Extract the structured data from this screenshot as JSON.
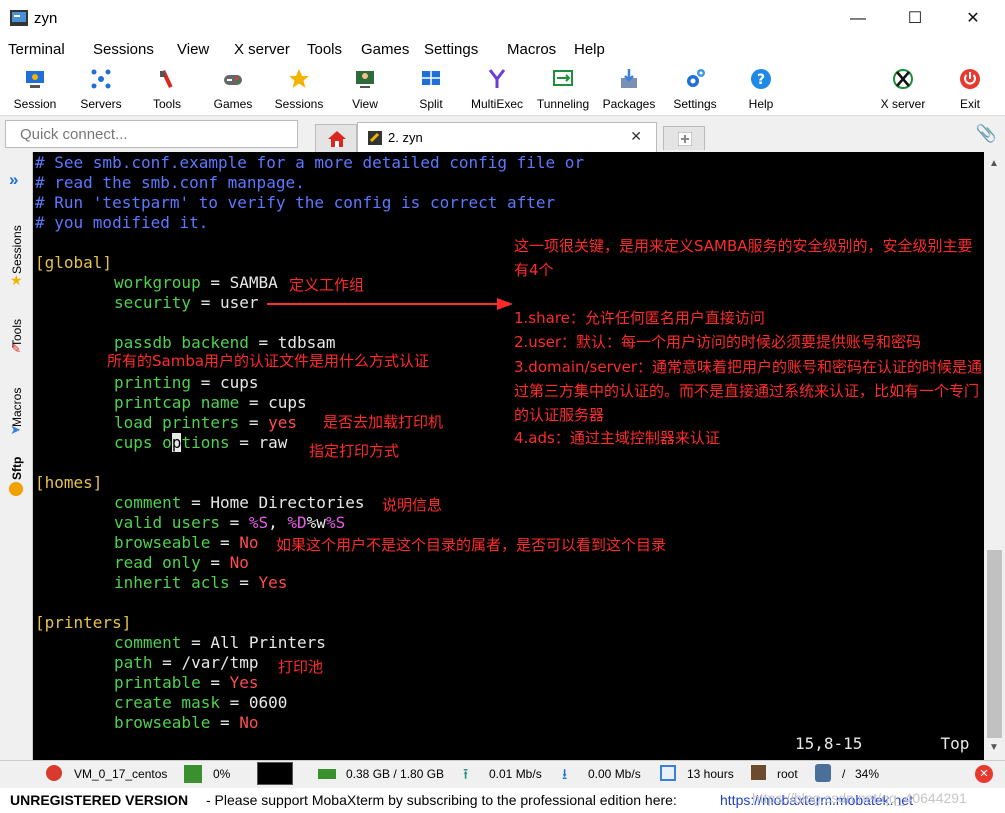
{
  "window": {
    "title": "zyn",
    "minimize": "—",
    "maximize": "☐",
    "close": "✕"
  },
  "menu": [
    "Terminal",
    "Sessions",
    "View",
    "X server",
    "Tools",
    "Games",
    "Settings",
    "Macros",
    "Help"
  ],
  "toolbar": [
    {
      "label": "Session",
      "icon": "session-icon",
      "color": "#1e6fd9"
    },
    {
      "label": "Servers",
      "icon": "servers-icon",
      "color": "#1e6fd9"
    },
    {
      "label": "Tools",
      "icon": "tools-icon",
      "color": "#d9261e"
    },
    {
      "label": "Games",
      "icon": "games-icon",
      "color": "#555555"
    },
    {
      "label": "Sessions",
      "icon": "star-icon",
      "color": "#f2b400"
    },
    {
      "label": "View",
      "icon": "view-icon",
      "color": "#1e8f3a"
    },
    {
      "label": "Split",
      "icon": "split-icon",
      "color": "#1e6fd9"
    },
    {
      "label": "MultiExec",
      "icon": "multiexec-icon",
      "color": "#6a3ed9"
    },
    {
      "label": "Tunneling",
      "icon": "tunneling-icon",
      "color": "#1e8f3a"
    },
    {
      "label": "Packages",
      "icon": "packages-icon",
      "color": "#3a7fd9"
    },
    {
      "label": "Settings",
      "icon": "gear-icon",
      "color": "#1e6fd9"
    },
    {
      "label": "Help",
      "icon": "help-icon",
      "color": "#1e8ae6"
    },
    {
      "label": "X server",
      "icon": "xserver-icon",
      "color": "#1e8f3a"
    },
    {
      "label": "Exit",
      "icon": "exit-icon",
      "color": "#e63a2e"
    }
  ],
  "quick_connect": {
    "placeholder": "Quick connect..."
  },
  "tabs": {
    "active": "2. zyn",
    "close": "✕"
  },
  "side_tabs": [
    "Sessions",
    "Tools",
    "Macros",
    "Sftp"
  ],
  "terminal": {
    "comments": [
      "# See smb.conf.example for a more detailed config file or",
      "# read the smb.conf manpage.",
      "# Run 'testparm' to verify the config is correct after",
      "# you modified it."
    ],
    "global": {
      "header": "[global]",
      "workgroup": {
        "key": "workgroup",
        "value": "SAMBA"
      },
      "security": {
        "key": "security",
        "value": "user"
      },
      "passdb": {
        "key": "passdb backend",
        "value": "tdbsam"
      },
      "printing": {
        "key": "printing",
        "value": "cups"
      },
      "printcap": {
        "key": "printcap name",
        "value": "cups"
      },
      "load_printers": {
        "key": "load printers",
        "value": "yes"
      },
      "cups_options": {
        "key_a": "cups o",
        "cursor": "p",
        "key_b": "tions",
        "value": "raw"
      }
    },
    "homes": {
      "header": "[homes]",
      "comment": {
        "key": "comment",
        "value": "Home Directories"
      },
      "valid_users": {
        "key": "valid users",
        "v1": "%S",
        "sep": ", ",
        "v2a": "%D",
        "v2b": "%w",
        "v2c": "%S"
      },
      "browseable": {
        "key": "browseable",
        "value": "No"
      },
      "read_only": {
        "key": "read only",
        "value": "No"
      },
      "inherit_acls": {
        "key": "inherit acls",
        "value": "Yes"
      }
    },
    "printers": {
      "header": "[printers]",
      "comment": {
        "key": "comment",
        "value": "All Printers"
      },
      "path": {
        "key": "path",
        "value": "/var/tmp"
      },
      "printable": {
        "key": "printable",
        "value": "Yes"
      },
      "create_mask": {
        "key": "create mask",
        "value": "0600"
      },
      "browseable": {
        "key": "browseable",
        "value": "No"
      }
    },
    "eq": " = ",
    "position": "15,8-15",
    "scroll": "Top"
  },
  "annotations": {
    "workgroup": "定义工作组",
    "security_title": "这一项很关键，是用来定义SAMBA服务的安全级别的，安全级别主要有4个",
    "security_1": "1.share：允许任何匿名用户直接访问",
    "security_2": "2.user：默认：每一个用户访问的时候必须要提供账号和密码",
    "security_3": "3.domain/server：通常意味着把用户的账号和密码在认证的时候是通过第三方集中的认证的。而不是直接通过系统来认证，比如有一个专门的认证服务器",
    "security_4": "4.ads：通过主域控制器来认证",
    "passdb": "所有的Samba用户的认证文件是用什么方式认证",
    "load_printers": "是否去加载打印机",
    "cups_options": "指定打印方式",
    "comment": "说明信息",
    "browseable": "如果这个用户不是这个目录的属者，是否可以看到这个目录",
    "path": "打印池"
  },
  "statusbar": {
    "host": "VM_0_17_centos",
    "cpu": "0%",
    "memory": "0.38 GB / 1.80 GB",
    "upload": "0.01 Mb/s",
    "download": "0.00 Mb/s",
    "uptime": "13 hours",
    "user": "root",
    "disk_sep": "/",
    "disk": "34%"
  },
  "footer": {
    "unregistered": "UNREGISTERED VERSION",
    "message": "-  Please support MobaXterm by subscribing to the professional edition here:",
    "link": "https://mobaxterm.mobatek.net",
    "watermark": "https://blog.csdn.net/qq_40644291"
  }
}
